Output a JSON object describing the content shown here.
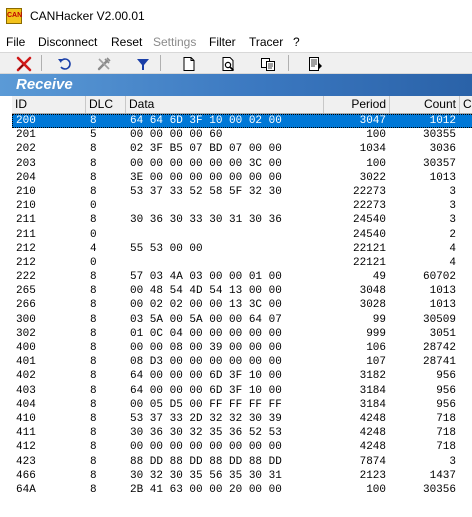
{
  "window": {
    "title": "CANHacker V2.00.01",
    "icon_text": "CAN"
  },
  "menu": [
    {
      "label": "File",
      "enabled": true
    },
    {
      "label": "Disconnect",
      "enabled": true
    },
    {
      "label": "Reset",
      "enabled": true
    },
    {
      "label": "Settings",
      "enabled": false
    },
    {
      "label": "Filter",
      "enabled": true
    },
    {
      "label": "Tracer",
      "enabled": true
    },
    {
      "label": "?",
      "enabled": true
    }
  ],
  "toolbar": {
    "buttons": [
      "disconnect-icon",
      "reset-icon",
      "settings-icon",
      "filter-icon",
      "new-icon",
      "preview-icon",
      "copy-icon",
      "export-icon"
    ]
  },
  "receive": {
    "title": "Receive",
    "columns": [
      "ID",
      "DLC",
      "Data",
      "Period",
      "Count",
      "C"
    ],
    "rows": [
      {
        "id": "200",
        "dlc": "8",
        "data": "64 64 6D 3F 10 00 02 00",
        "period": "3047",
        "count": "1012",
        "selected": true
      },
      {
        "id": "201",
        "dlc": "5",
        "data": "00 00 00 00 60",
        "period": "100",
        "count": "30355"
      },
      {
        "id": "202",
        "dlc": "8",
        "data": "02 3F B5 07 BD 07 00 00",
        "period": "1034",
        "count": "3036"
      },
      {
        "id": "203",
        "dlc": "8",
        "data": "00 00 00 00 00 00 3C 00",
        "period": "100",
        "count": "30357"
      },
      {
        "id": "204",
        "dlc": "8",
        "data": "3E 00 00 00 00 00 00 00",
        "period": "3022",
        "count": "1013"
      },
      {
        "id": "210",
        "dlc": "8",
        "data": "53 37 33 52 58 5F 32 30",
        "period": "22273",
        "count": "3"
      },
      {
        "id": "210",
        "dlc": "0",
        "data": "",
        "period": "22273",
        "count": "3"
      },
      {
        "id": "211",
        "dlc": "8",
        "data": "30 36 30 33 30 31 30 36",
        "period": "24540",
        "count": "3"
      },
      {
        "id": "211",
        "dlc": "0",
        "data": "",
        "period": "24540",
        "count": "2"
      },
      {
        "id": "212",
        "dlc": "4",
        "data": "55 53 00 00",
        "period": "22121",
        "count": "4"
      },
      {
        "id": "212",
        "dlc": "0",
        "data": "",
        "period": "22121",
        "count": "4"
      },
      {
        "id": "222",
        "dlc": "8",
        "data": "57 03 4A 03 00 00 01 00",
        "period": "49",
        "count": "60702"
      },
      {
        "id": "265",
        "dlc": "8",
        "data": "00 48 54 4D 54 13 00 00",
        "period": "3048",
        "count": "1013"
      },
      {
        "id": "266",
        "dlc": "8",
        "data": "00 02 02 00 00 13 3C 00",
        "period": "3028",
        "count": "1013"
      },
      {
        "id": "300",
        "dlc": "8",
        "data": "03 5A 00 5A 00 00 64 07",
        "period": "99",
        "count": "30509"
      },
      {
        "id": "302",
        "dlc": "8",
        "data": "01 0C 04 00 00 00 00 00",
        "period": "999",
        "count": "3051"
      },
      {
        "id": "400",
        "dlc": "8",
        "data": "00 00 08 00 39 00 00 00",
        "period": "106",
        "count": "28742"
      },
      {
        "id": "401",
        "dlc": "8",
        "data": "08 D3 00 00 00 00 00 00",
        "period": "107",
        "count": "28741"
      },
      {
        "id": "402",
        "dlc": "8",
        "data": "64 00 00 00 6D 3F 10 00",
        "period": "3182",
        "count": "956"
      },
      {
        "id": "403",
        "dlc": "8",
        "data": "64 00 00 00 6D 3F 10 00",
        "period": "3184",
        "count": "956"
      },
      {
        "id": "404",
        "dlc": "8",
        "data": "00 05 D5 00 FF FF FF FF",
        "period": "3184",
        "count": "956"
      },
      {
        "id": "410",
        "dlc": "8",
        "data": "53 37 33 2D 32 32 30 39",
        "period": "4248",
        "count": "718"
      },
      {
        "id": "411",
        "dlc": "8",
        "data": "30 36 30 32 35 36 52 53",
        "period": "4248",
        "count": "718"
      },
      {
        "id": "412",
        "dlc": "8",
        "data": "00 00 00 00 00 00 00 00",
        "period": "4248",
        "count": "718"
      },
      {
        "id": "423",
        "dlc": "8",
        "data": "88 DD 88 DD 88 DD 88 DD",
        "period": "7874",
        "count": "3"
      },
      {
        "id": "466",
        "dlc": "8",
        "data": "30 32 30 35 56 35 30 31",
        "period": "2123",
        "count": "1437"
      },
      {
        "id": "64A",
        "dlc": "8",
        "data": "2B 41 63 00 00 20 00 00",
        "period": "100",
        "count": "30356"
      }
    ]
  },
  "colors": {
    "selection": "#0078d7",
    "receive_header": "#3b78c0"
  }
}
